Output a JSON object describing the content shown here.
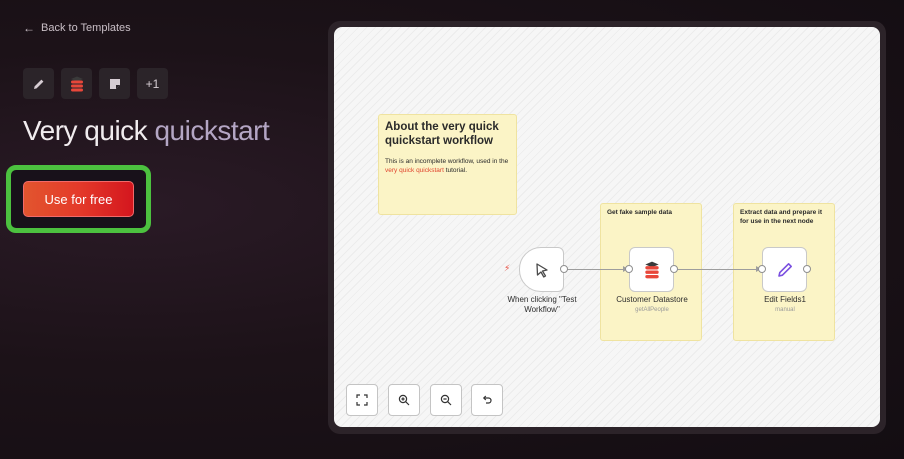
{
  "nav": {
    "back_label": "Back to Templates"
  },
  "integrations": {
    "extra_count": "+1",
    "icons": [
      "pencil-icon",
      "datastore-icon",
      "sticky-note-icon"
    ]
  },
  "page": {
    "title_main": "Very quick",
    "title_accent": "quickstart"
  },
  "cta": {
    "label": "Use for free"
  },
  "canvas": {
    "about_note": {
      "title": "About the very quick quickstart workflow",
      "body_pre": "This is an incomplete workflow, used in the ",
      "body_link": "very quick quickstart",
      "body_post": " tutorial."
    },
    "group_data": {
      "label": "Get fake sample data"
    },
    "group_extract": {
      "label": "Extract data and prepare it for use in the next node"
    },
    "nodes": {
      "trigger": {
        "title": "When clicking \"Test Workflow\""
      },
      "datastore": {
        "title": "Customer Datastore",
        "subtitle": "getAllPeople"
      },
      "edit": {
        "title": "Edit Fields1",
        "subtitle": "manual"
      }
    }
  },
  "colors": {
    "accent_green": "#4cc13f",
    "cta_gradient_start": "#e2552e",
    "cta_gradient_end": "#d4161e",
    "sticky_yellow": "#fbf4c6",
    "edit_purple": "#7a4fe0"
  }
}
